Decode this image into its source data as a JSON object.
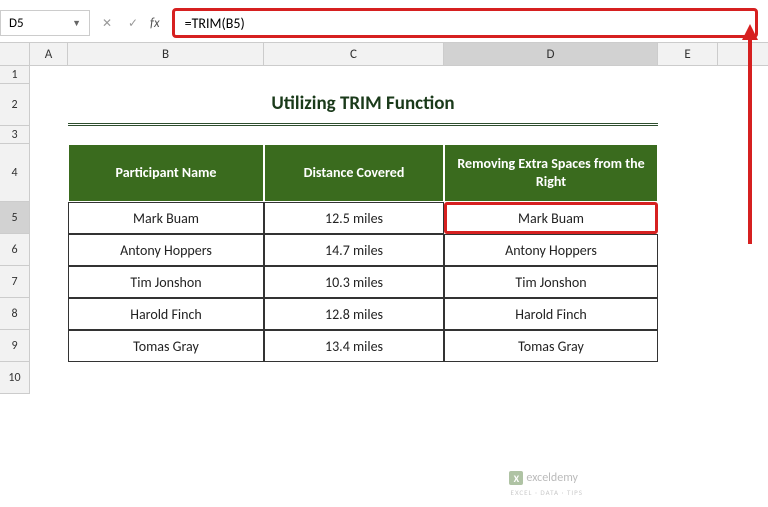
{
  "name_box": "D5",
  "fx_label": "fx",
  "formula": "=TRIM(B5)",
  "columns": [
    "A",
    "B",
    "C",
    "D",
    "E"
  ],
  "row_numbers": [
    "1",
    "2",
    "3",
    "4",
    "5",
    "6",
    "7",
    "8",
    "9",
    "10"
  ],
  "title": "Utilizing TRIM Function",
  "headers": {
    "b": "Participant Name",
    "c": "Distance Covered",
    "d": "Removing Extra Spaces from the Right"
  },
  "data_rows": [
    {
      "name": "Mark Buam",
      "dist": "12.5 miles",
      "result": "Mark Buam"
    },
    {
      "name": "Antony Hoppers",
      "dist": "14.7 miles",
      "result": "Antony Hoppers"
    },
    {
      "name": "Tim Jonshon",
      "dist": "10.3 miles",
      "result": "Tim Jonshon"
    },
    {
      "name": "Harold Finch",
      "dist": "12.8 miles",
      "result": "Harold Finch"
    },
    {
      "name": "Tomas Gray",
      "dist": "13.4 miles",
      "result": "Tomas Gray"
    }
  ],
  "watermark": "exceldemy",
  "watermark_sub": "EXCEL · DATA · TIPS"
}
